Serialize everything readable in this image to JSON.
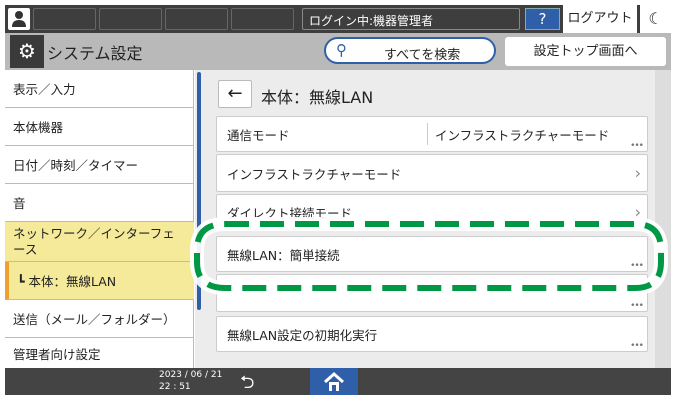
{
  "topbar": {
    "login_status": "ログイン中:機器管理者",
    "help": "?",
    "logout": "ログアウト",
    "moon_icon": "moon-icon"
  },
  "header": {
    "title": "システム設定",
    "search": "すべてを検索",
    "settings_top": "設定トップ画面へ"
  },
  "sidebar": {
    "items": [
      {
        "label": "表示／入力"
      },
      {
        "label": "本体機器"
      },
      {
        "label": "日付／時刻／タイマー"
      },
      {
        "label": "音"
      },
      {
        "label": "ネットワーク／インターフェース"
      },
      {
        "label": "┗ 本体：無線LAN"
      },
      {
        "label": "送信（メール／フォルダー）"
      },
      {
        "label": "管理者向け設定"
      }
    ],
    "selected": "┗ 本体：無線LAN"
  },
  "main": {
    "title": "本体：無線LAN",
    "rows": [
      {
        "label": "通信モード",
        "value": "インフラストラクチャーモード"
      },
      {
        "label": "インフラストラクチャーモード"
      },
      {
        "label": "ダイレクト接続モード"
      },
      {
        "label": "無線LAN：簡単接続"
      },
      {
        "label": ""
      },
      {
        "label": "無線LAN設定の初期化実行"
      }
    ]
  },
  "footer": {
    "date": "2023 / 06 / 21",
    "time": "22 : 51"
  },
  "colors": {
    "accent": "#2f5fa8",
    "highlight": "#009844",
    "selected_bg": "#f5ea9a",
    "selected_bar": "#f0a030"
  }
}
